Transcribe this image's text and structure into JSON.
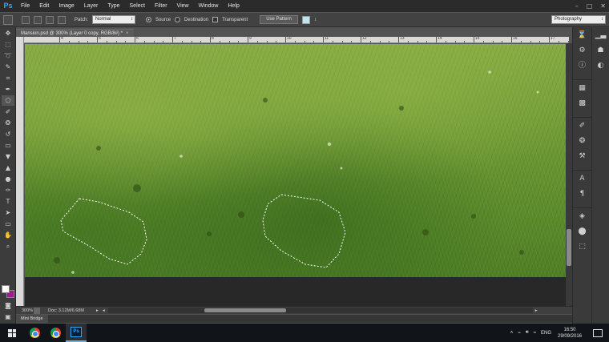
{
  "app": {
    "logo": "Ps"
  },
  "menu": [
    "File",
    "Edit",
    "Image",
    "Layer",
    "Type",
    "Select",
    "Filter",
    "View",
    "Window",
    "Help"
  ],
  "window_controls": {
    "minimize": "–",
    "maximize": "□",
    "close": "✕"
  },
  "options": {
    "patch_label": "Patch:",
    "patch_mode": "Normal",
    "source_label": "Source",
    "destination_label": "Destination",
    "transparent_label": "Transparent",
    "use_pattern_label": "Use Pattern",
    "workspace": "Photography",
    "pattern_swatch_color": "#bfe4f2"
  },
  "document": {
    "tab_title": "Mansion.psd @ 300% (Layer 0 copy, RGB/8#) *",
    "close": "×"
  },
  "ruler_labels": [
    "4",
    "5",
    "6",
    "7",
    "8",
    "9",
    "10",
    "11",
    "12",
    "13",
    "14",
    "15",
    "16",
    "17"
  ],
  "colors": {
    "foreground": "#ffffff",
    "background": "#9b1c8c",
    "accent": "#31a8ff"
  },
  "status": {
    "zoom": "300%",
    "doc_size": "Doc: 3.12M/6.68M",
    "arrow": "▸",
    "scroll_left": "◂",
    "scroll_right": "▸"
  },
  "mini_bridge": {
    "label": "Mini Bridge"
  },
  "tools": [
    "move-tool-icon",
    "marquee-tool-icon",
    "lasso-tool-icon",
    "quick-select-tool-icon",
    "crop-tool-icon",
    "eyedropper-tool-icon",
    "patch-tool-icon",
    "brush-tool-icon",
    "clone-stamp-tool-icon",
    "history-brush-tool-icon",
    "eraser-tool-icon",
    "paint-bucket-tool-icon",
    "blur-tool-icon",
    "dodge-tool-icon",
    "pen-tool-icon",
    "type-tool-icon",
    "path-select-tool-icon",
    "rectangle-tool-icon",
    "hand-tool-icon",
    "zoom-tool-icon"
  ],
  "taskbar": {
    "language": "ENG",
    "time": "16:50",
    "date": "29/09/2016"
  }
}
